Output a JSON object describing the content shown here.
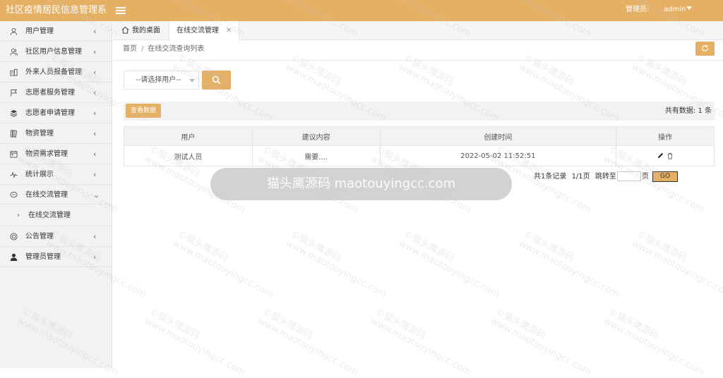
{
  "app": {
    "title": "社区疫情居民信息管理系",
    "admin_label": "管理员:",
    "admin_name": "admin"
  },
  "sidebar": {
    "items": [
      {
        "label": "用户管理",
        "icon": "user-icon"
      },
      {
        "label": "社区用户信息管理",
        "icon": "users-icon"
      },
      {
        "label": "外来人员报备管理",
        "icon": "building-icon"
      },
      {
        "label": "志愿者服务管理",
        "icon": "flag-icon"
      },
      {
        "label": "志愿者申请管理",
        "icon": "layers-icon"
      },
      {
        "label": "物资管理",
        "icon": "book-icon"
      },
      {
        "label": "物资需求管理",
        "icon": "calendar-icon"
      },
      {
        "label": "统计展示",
        "icon": "chart-icon"
      },
      {
        "label": "在线交流管理",
        "icon": "chat-icon"
      },
      {
        "label": "公告管理",
        "icon": "bell-icon"
      },
      {
        "label": "管理员管理",
        "icon": "admin-icon"
      }
    ],
    "sub_items": [
      {
        "label": "在线交流管理"
      }
    ]
  },
  "tabs": {
    "home": "我的桌面",
    "active": "在线交流管理"
  },
  "breadcrumb": {
    "home": "首页",
    "sep": "/",
    "current": "在线交流查询列表"
  },
  "search": {
    "select_value": "--请选择用户--"
  },
  "toolbar": {
    "view_button": "查看数据",
    "count_label": "共有数据: 1 条"
  },
  "table": {
    "headers": [
      "用户",
      "建议内容",
      "创建时间",
      "操作"
    ],
    "rows": [
      [
        "测试人员",
        "需要....",
        "2022-05-02 11:52:51"
      ]
    ]
  },
  "pagination": {
    "summary": "共1条记录",
    "pages": "1/1页",
    "jump_to": "跳转至",
    "page_unit": "页",
    "go": "GO"
  },
  "watermark": {
    "banner": "猫头鹰源码 maotouyingcc.com",
    "tile_line1": "©猫头鹰源码",
    "tile_line2": "www.maotouyingcc.com"
  },
  "colors": {
    "accent": "#e5b064",
    "sidebar_bg": "#f2f2f2"
  }
}
